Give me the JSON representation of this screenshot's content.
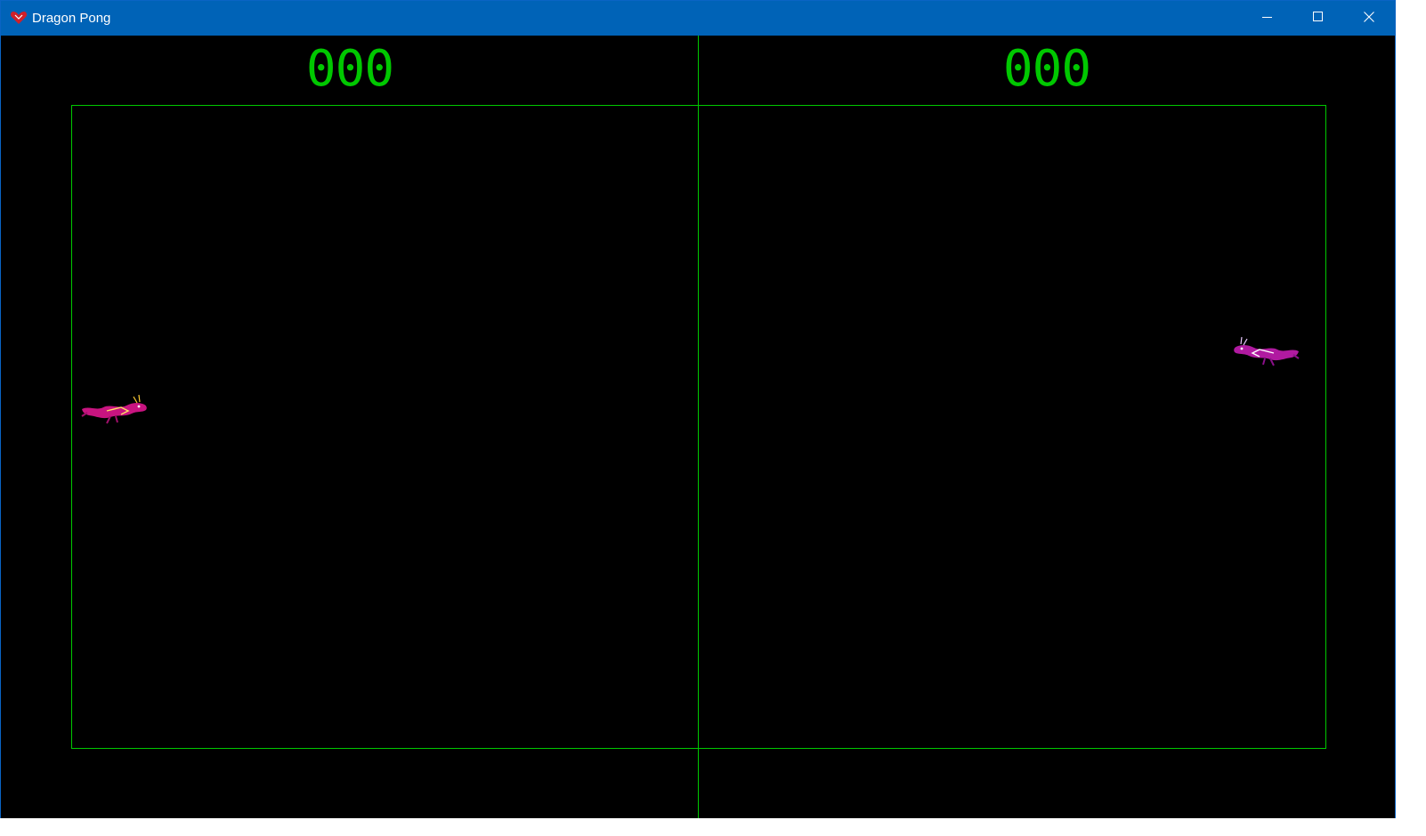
{
  "window": {
    "title": "Dragon Pong",
    "icon": "heart-dragon-icon",
    "buttons": {
      "minimize": "minimize-icon",
      "maximize": "maximize-icon",
      "close": "close-icon"
    }
  },
  "game": {
    "score_left": "000",
    "score_right": "000",
    "line_color": "#00c800",
    "score_color": "#00c800",
    "background": "#000000",
    "dragon_color": "#c81480"
  }
}
